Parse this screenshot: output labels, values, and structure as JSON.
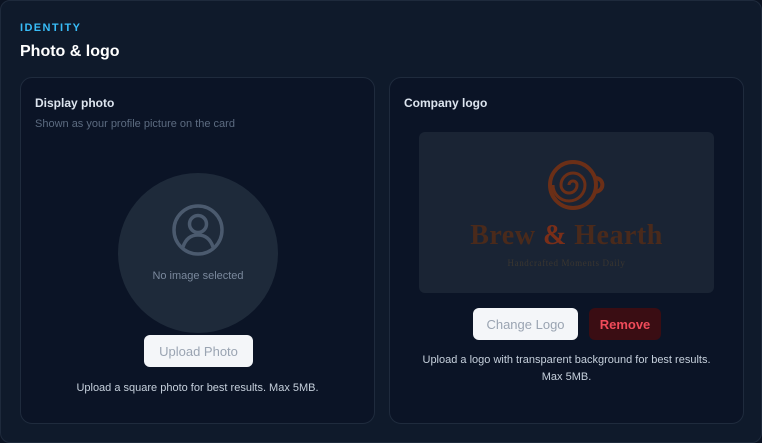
{
  "section": {
    "eyebrow": "IDENTITY",
    "title": "Photo & logo"
  },
  "display_photo": {
    "title": "Display photo",
    "subtitle": "Shown as your profile picture on the card",
    "placeholder_icon": "user-circle-icon",
    "placeholder_text": "No image selected",
    "upload_label": "Upload Photo",
    "hint": "Upload a square photo for best results. Max 5MB."
  },
  "company_logo": {
    "title": "Company logo",
    "logo": {
      "name_part1": "Brew",
      "ampersand": "&",
      "name_part2": "Hearth",
      "tagline": "Handcrafted Moments Daily",
      "mark_icon": "coffee-cup-icon"
    },
    "change_label": "Change Logo",
    "remove_label": "Remove",
    "hint": "Upload a logo with transparent background for best results. Max 5MB."
  },
  "colors": {
    "accent": "#38bdf8",
    "danger": "#f04b5a",
    "background": "#0f1a2b"
  }
}
